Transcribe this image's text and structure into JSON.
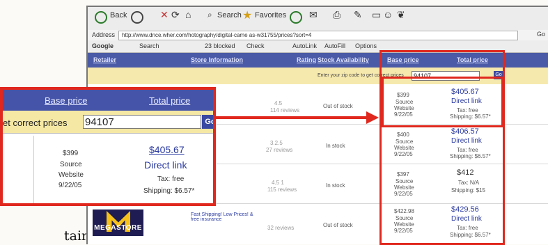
{
  "background_text": "tain at",
  "toolbar": {
    "back": "Back",
    "search": "Search",
    "favorites": "Favorites"
  },
  "address": {
    "label": "Address",
    "url": "http://www.dnce.wher.com/hotography/digital-came as-w31755/prices?sort=4",
    "go": "Go"
  },
  "gbar": {
    "logo": "Google",
    "search": "Search",
    "blocked": "23 blocked",
    "check": "Check",
    "autolink": "AutoLink",
    "autofill": "AutoFill",
    "options": "Options"
  },
  "table": {
    "headers": [
      "Retailer",
      "Store Information",
      "Rating",
      "Stock Availability",
      "Base price",
      "Total price"
    ],
    "zip_prompt": "Enter your zip code to get correct prices",
    "zip_value": "94107",
    "go": "Go",
    "rows": [
      {
        "retailer": "",
        "info": "",
        "rating": "4.5",
        "rating_sub": "114 reviews",
        "stock": "Out of stock",
        "base": [
          "$399",
          "Source",
          "Website",
          "9/22/05"
        ],
        "total": "$405.67",
        "link": "Direct link",
        "tax": "Tax: free",
        "ship": "Shipping: $6.57*"
      },
      {
        "retailer": "",
        "info": "",
        "rating": "3.2.5",
        "rating_sub": "27 reviews",
        "stock": "In stock",
        "base": [
          "$400",
          "Source",
          "Website",
          "9/22/05"
        ],
        "total": "$406.57",
        "link": "Direct link",
        "tax": "Tax: free",
        "ship": "Shipping: $6.57*"
      },
      {
        "retailer": "",
        "info": "",
        "rating": "4.5 1",
        "rating_sub": "115 reviews",
        "stock": "In stock",
        "base": [
          "$397",
          "Source",
          "Website",
          "9/22/05"
        ],
        "total": "$412",
        "link": "",
        "tax": "Tax: N/A",
        "ship": "Shipping: $15"
      },
      {
        "retailer": "MEGASTORE",
        "info": "Fast Shipping! Low Prices! & free insurance",
        "rating": "",
        "rating_sub": "32 reviews",
        "stock": "Out of stock",
        "base": [
          "$422.98",
          "Source",
          "Website",
          "9/22/05"
        ],
        "total": "$429.56",
        "link": "Direct link",
        "tax": "Tax: free",
        "ship": "Shipping: $6.57*"
      }
    ]
  },
  "zoom": {
    "base_header": "Base price",
    "total_header": "Total price",
    "prompt": "et correct prices",
    "zip_value": "94107",
    "go": "Go",
    "base": [
      "$399",
      "Source",
      "Website",
      "9/22/05"
    ],
    "total": "$405.67",
    "link": "Direct link",
    "tax": "Tax: free",
    "ship": "Shipping: $6.57*"
  },
  "colors": {
    "highlight": "#e0281e",
    "header_blue": "#4a5aa6",
    "zip_bar": "#f6e9ae"
  }
}
